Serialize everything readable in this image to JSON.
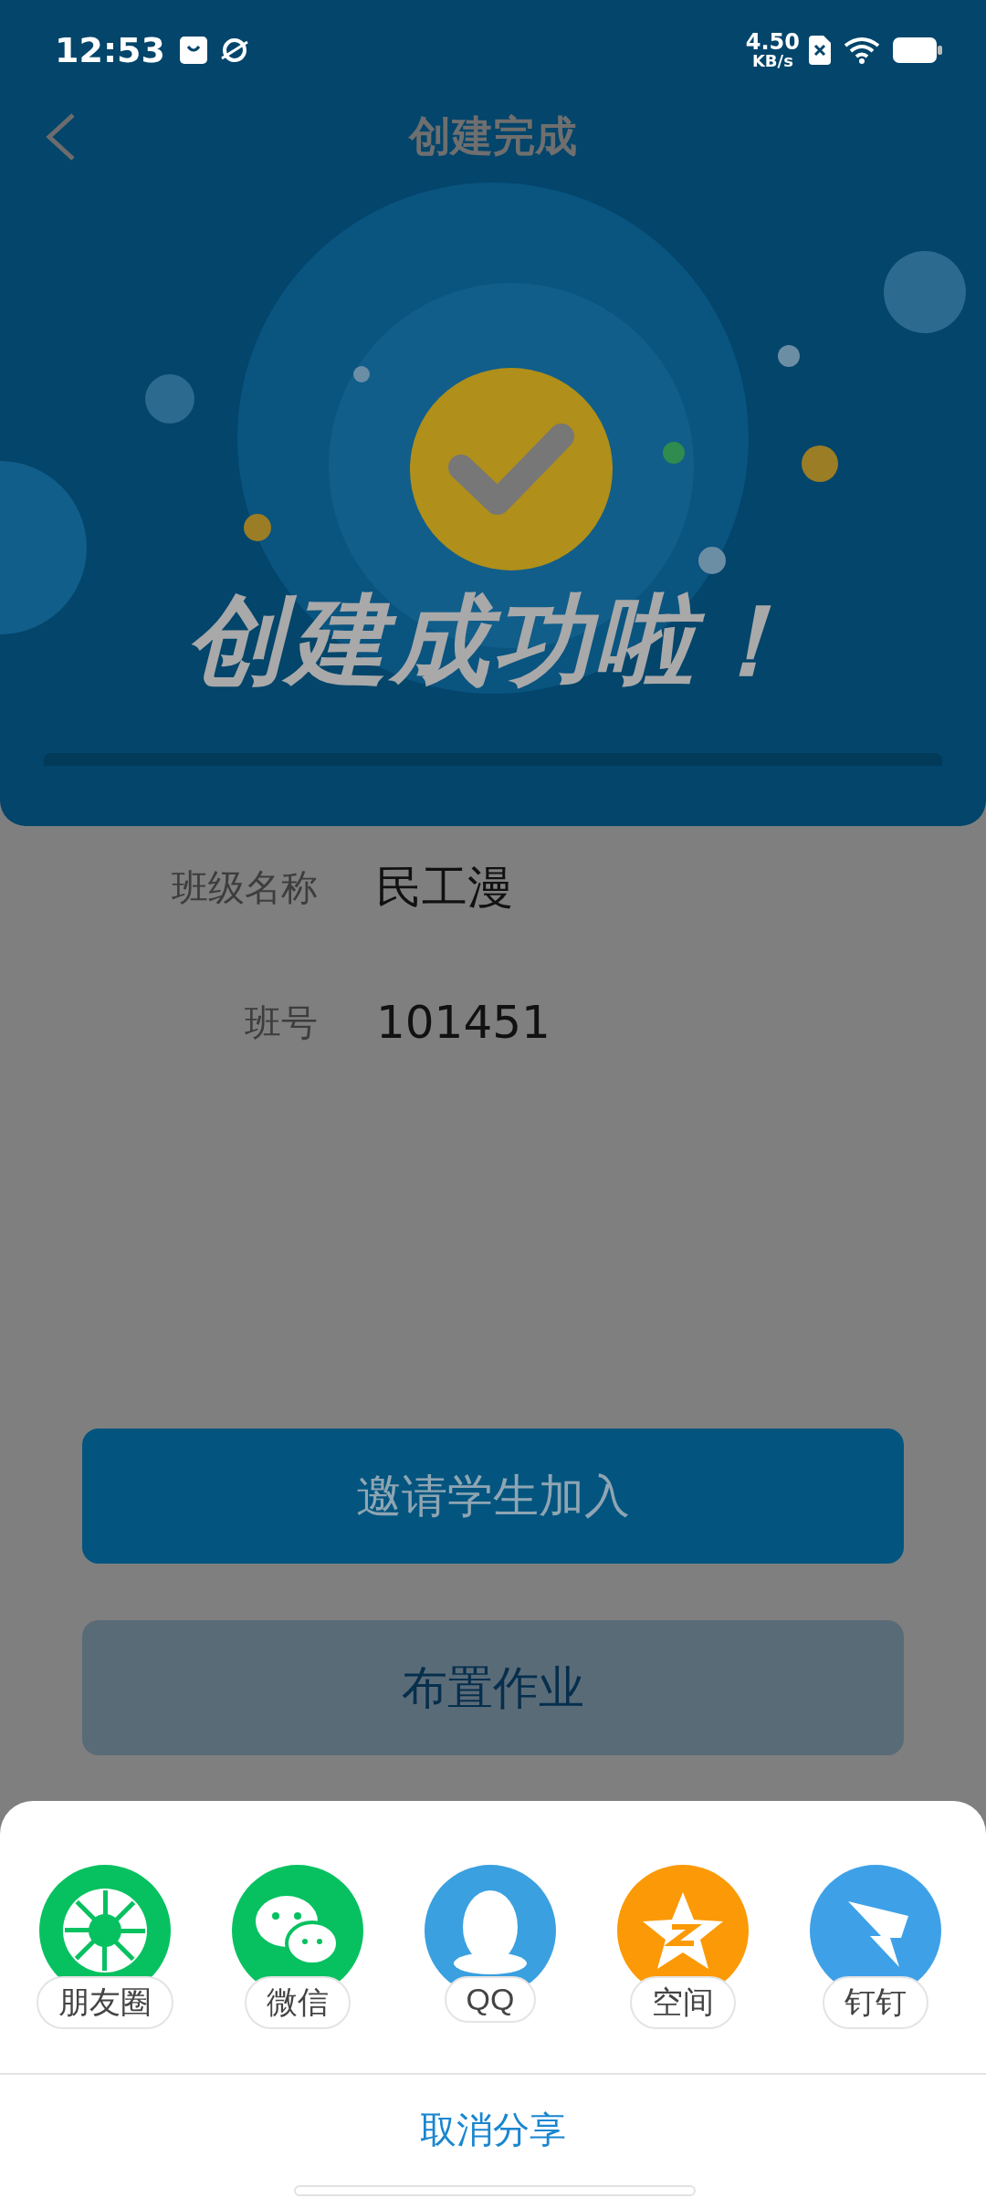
{
  "status_bar": {
    "time": "12:53",
    "net_speed": "4.50",
    "net_unit": "KB/s"
  },
  "header": {
    "title": "创建完成"
  },
  "banner": {
    "slogan": "创建成功啦！"
  },
  "info": [
    {
      "label": "班级名称",
      "value": "民工漫"
    },
    {
      "label": "班号",
      "value": "101451"
    }
  ],
  "buttons": [
    {
      "label": "邀请学生加入",
      "kind": "primary"
    },
    {
      "label": "布置作业",
      "kind": "secondary"
    }
  ],
  "share_sheet": {
    "items": [
      {
        "label": "朋友圈",
        "kind": "moments",
        "color": "#07c160"
      },
      {
        "label": "微信",
        "kind": "wechat",
        "color": "#07c160"
      },
      {
        "label": "QQ",
        "kind": "qq",
        "color": "#3aa0e0"
      },
      {
        "label": "空间",
        "kind": "qzone",
        "color": "#fb9a06"
      },
      {
        "label": "钉钉",
        "kind": "dingtalk",
        "color": "#3ea1e8"
      }
    ],
    "cancel": "取消分享"
  }
}
